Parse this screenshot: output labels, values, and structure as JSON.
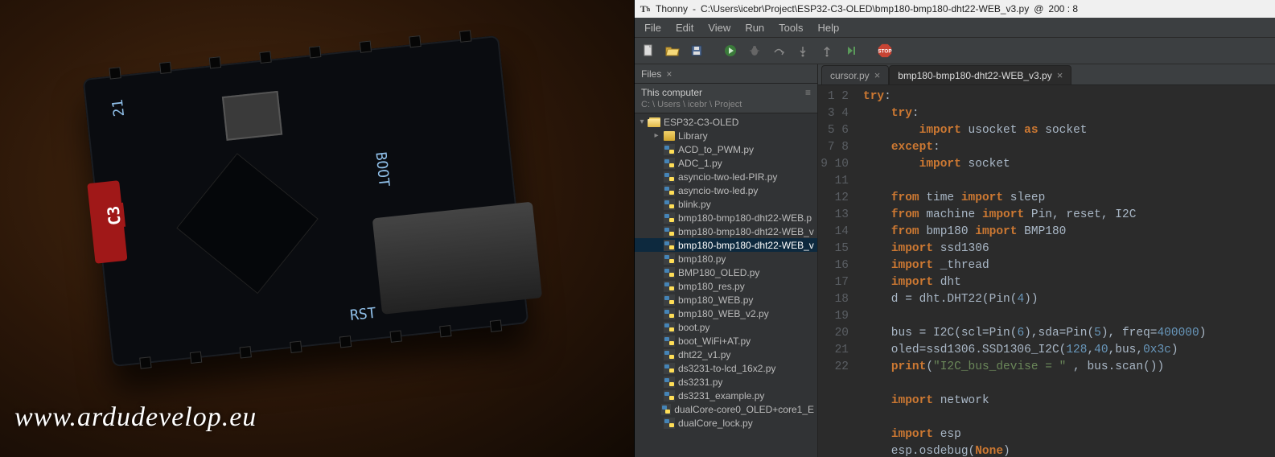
{
  "photo": {
    "watermark": "www.ardudevelop.eu",
    "silk_labels": {
      "s21": "21",
      "boot": "BOOT",
      "rst": "RST",
      "c3": "C3"
    }
  },
  "titlebar": {
    "app": "Thonny",
    "sep": "  -  ",
    "path": "C:\\Users\\icebr\\Project\\ESP32-C3-OLED\\bmp180-bmp180-dht22-WEB_v3.py",
    "at": "  @  ",
    "cursor": "200 : 8"
  },
  "menu": [
    "File",
    "Edit",
    "View",
    "Run",
    "Tools",
    "Help"
  ],
  "toolbar": {
    "new": "new-file-icon",
    "open": "open-file-icon",
    "save": "save-icon",
    "run": "run-icon",
    "debug": "debug-icon",
    "step_over": "step-over-icon",
    "step_into": "step-into-icon",
    "step_out": "step-out-icon",
    "resume": "resume-icon",
    "stop": "STOP"
  },
  "files_panel": {
    "tab_label": "Files",
    "header": "This computer",
    "path": "C: \\ Users \\ icebr \\ Project",
    "root": "ESP32-C3-OLED",
    "subfolder": "Library",
    "files": [
      "ACD_to_PWM.py",
      "ADC_1.py",
      "asyncio-two-led-PIR.py",
      "asyncio-two-led.py",
      "blink.py",
      "bmp180-bmp180-dht22-WEB.p",
      "bmp180-bmp180-dht22-WEB_v",
      "bmp180-bmp180-dht22-WEB_v",
      "bmp180.py",
      "BMP180_OLED.py",
      "bmp180_res.py",
      "bmp180_WEB.py",
      "bmp180_WEB_v2.py",
      "boot.py",
      "boot_WiFi+AT.py",
      "dht22_v1.py",
      "ds3231-to-lcd_16x2.py",
      "ds3231.py",
      "ds3231_example.py",
      "dualCore-core0_OLED+core1_E",
      "dualCore_lock.py"
    ],
    "selected_index": 7
  },
  "tabs": [
    {
      "label": "cursor.py",
      "active": false
    },
    {
      "label": "bmp180-bmp180-dht22-WEB_v3.py",
      "active": true
    }
  ],
  "code": {
    "first_line": 1,
    "lines": [
      "try:",
      "    try:",
      "        import usocket as socket",
      "    except:",
      "        import socket",
      "",
      "    from time import sleep",
      "    from machine import Pin, reset, I2C",
      "    from bmp180 import BMP180",
      "    import ssd1306",
      "    import _thread",
      "    import dht",
      "    d = dht.DHT22(Pin(4))",
      "",
      "    bus = I2C(scl=Pin(6),sda=Pin(5), freq=400000)",
      "    oled=ssd1306.SSD1306_I2C(128,40,bus,0x3c)",
      "    print(\"I2C_bus_devise = \" , bus.scan())",
      "",
      "    import network",
      "",
      "    import esp",
      "    esp.osdebug(None)"
    ]
  }
}
